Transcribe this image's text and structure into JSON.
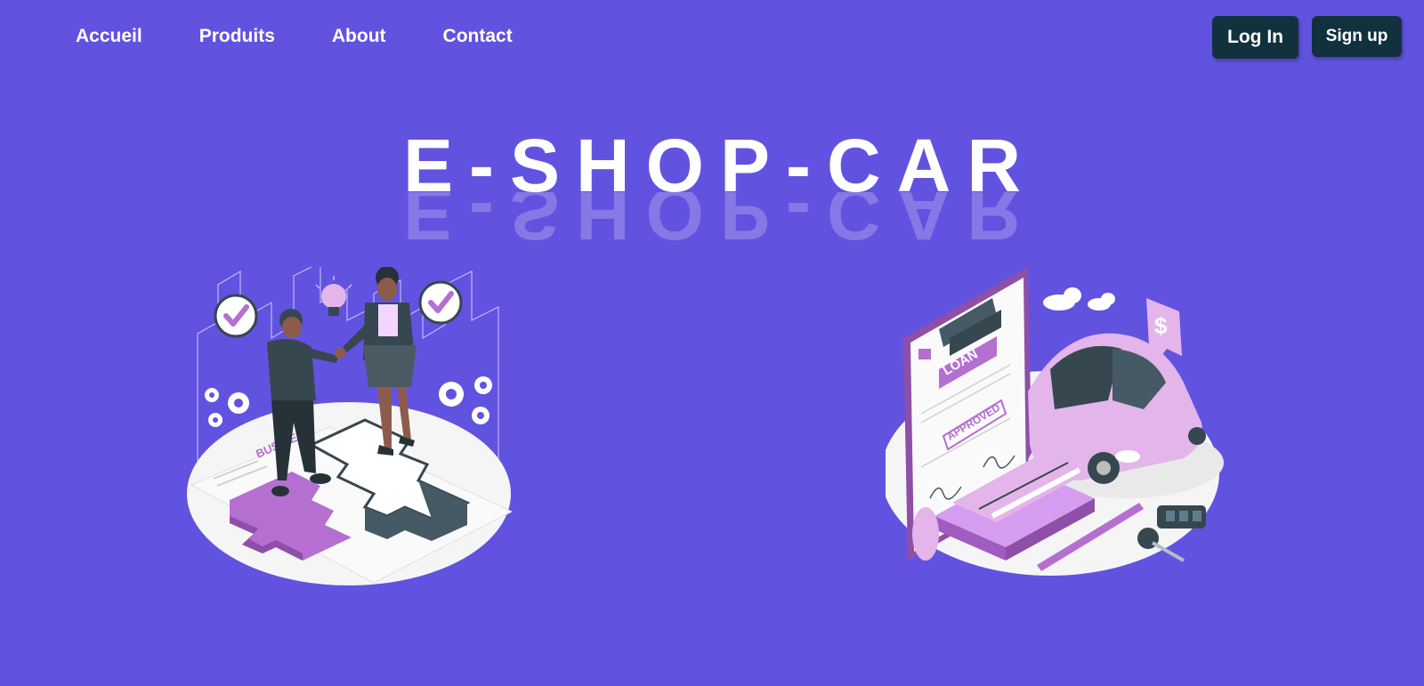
{
  "nav": {
    "links": [
      {
        "label": "Accueil"
      },
      {
        "label": "Produits"
      },
      {
        "label": "About"
      },
      {
        "label": "Contact"
      }
    ]
  },
  "auth": {
    "login_label": "Log In",
    "signup_label": "Sign up"
  },
  "hero": {
    "title": "E-SHOP-CAR"
  },
  "illustrations": {
    "left": {
      "icon": "business-handshake-illustration",
      "text": "BUSINESS"
    },
    "right": {
      "icon": "car-loan-approved-illustration",
      "loan_text": "LOAN",
      "stamp_text": "APPROVED",
      "dollar_text": "$"
    }
  },
  "colors": {
    "background": "#6153e0",
    "button": "#11313f",
    "accent_purple": "#b46fd1",
    "light_purple": "#e3b5ea",
    "dark": "#37474f"
  }
}
